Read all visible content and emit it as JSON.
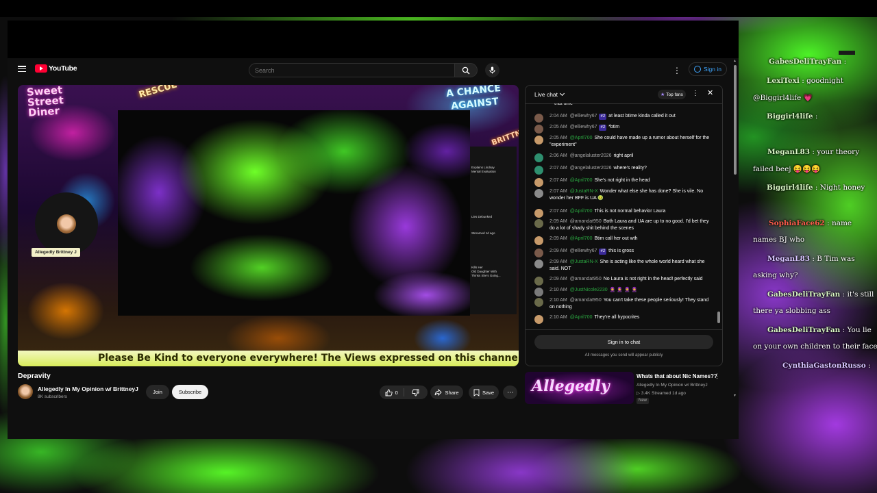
{
  "header": {
    "logo_text": "YouTube",
    "search_placeholder": "Search",
    "more_icon": "⋮",
    "sign_in_label": "Sign in"
  },
  "video": {
    "title": "Depravity",
    "overlay": {
      "sign_diner": "Sweet\nStreet\nDiner",
      "sign_rescue": "RESCUE",
      "sign_chance": "A CHANCE\nAGAINST",
      "sign_brittney": "BRITTNEY",
      "name_tag": "Allegedly Brittney J",
      "side_panel": [
        "Explains Lindsay",
        "Mental Evaluation",
        "Lies Debunked",
        "Streamed 1d ago",
        "Kills Her",
        "Old Daughter With",
        "Thinks She's Going..."
      ],
      "ticker": "Please Be Kind to everyone everywhere! The Views expressed on this channel by Gu"
    },
    "channel": {
      "name": "Allegedly In My Opinion w/ BrittneyJ",
      "subscribers": "8K subscribers"
    },
    "buttons": {
      "join": "Join",
      "subscribe": "Subscribe",
      "like_count": "0",
      "share": "Share",
      "save": "Save",
      "more": "⋯"
    }
  },
  "live_chat": {
    "title": "Live chat",
    "top_fans": "Top fans",
    "messages": [
      {
        "time": "",
        "author": "",
        "text": "that time",
        "author_color": "gray",
        "badge": ""
      },
      {
        "time": "2:04 AM",
        "author": "@elliewhy67",
        "text": "at least btime kinda called it out",
        "author_color": "gray",
        "badge": "#2"
      },
      {
        "time": "2:05 AM",
        "author": "@elliewhy67",
        "text": "*btim",
        "author_color": "gray",
        "badge": "#2"
      },
      {
        "time": "2:05 AM",
        "author": "@April700",
        "text": "She could have made up a rumor about herself for the \"experiment\"",
        "author_color": "green",
        "badge": ""
      },
      {
        "time": "2:06 AM",
        "author": "@angelaluster2026",
        "text": "right april",
        "author_color": "gray",
        "badge": ""
      },
      {
        "time": "2:07 AM",
        "author": "@angelaluster2026",
        "text": "where's reality?",
        "author_color": "gray",
        "badge": ""
      },
      {
        "time": "2:07 AM",
        "author": "@April700",
        "text": "She's not right in the head",
        "author_color": "green",
        "badge": ""
      },
      {
        "time": "2:07 AM",
        "author": "@JustaRN-X",
        "text": "Wonder what else she has done? She is vile. No wonder her BFF is UA 🤢",
        "author_color": "green",
        "badge": ""
      },
      {
        "time": "2:07 AM",
        "author": "@April700",
        "text": "This is not normal behavior Laura",
        "author_color": "green",
        "badge": ""
      },
      {
        "time": "2:09 AM",
        "author": "@amandat950",
        "text": "Both Laura and UA are up to no good. I'd bet they do a lot of shady shit behind the scenes",
        "author_color": "gray",
        "badge": ""
      },
      {
        "time": "2:09 AM",
        "author": "@April700",
        "text": "Btim call her out wth",
        "author_color": "green",
        "badge": ""
      },
      {
        "time": "2:09 AM",
        "author": "@elliewhy67",
        "text": "this is gross",
        "author_color": "gray",
        "badge": "#2"
      },
      {
        "time": "2:09 AM",
        "author": "@JustaRN-X",
        "text": "She is acting like the whole world heard what she said. NOT",
        "author_color": "green",
        "badge": ""
      },
      {
        "time": "2:09 AM",
        "author": "@amandat950",
        "text": "No Laura is not right in the head! perfectly said",
        "author_color": "gray",
        "badge": ""
      },
      {
        "time": "2:10 AM",
        "author": "@JustNicole2230",
        "text": "🧕 🧕 🧕 🧕",
        "author_color": "green",
        "badge": ""
      },
      {
        "time": "2:10 AM",
        "author": "@amandat950",
        "text": "You can't take these people seriously! They stand on nothing",
        "author_color": "gray",
        "badge": ""
      },
      {
        "time": "2:10 AM",
        "author": "@April700",
        "text": "They're all hypocrites",
        "author_color": "green",
        "badge": ""
      }
    ],
    "sign_in_chat": "Sign in to chat",
    "note": "All messages you send will appear publicly"
  },
  "recommendation": {
    "thumb_text": "Allegedly",
    "title": "Whats that about Nic Names??",
    "channel": "Allegedly In My Opinion w/ BrittneyJ",
    "stats": "▷ 3.4K  Streamed 1d ago",
    "badge": "New"
  },
  "overlay_chat": [
    {
      "name": "GabesDeliTrayFan",
      "text": ":",
      "color": "lg"
    },
    {
      "name": "LexiTexi",
      "text": ": goodnight",
      "color": "lg"
    },
    {
      "name": "",
      "text": "@Biggirl4life 💗",
      "color": ""
    },
    {
      "name": "Biggirl4life",
      "text": ":",
      "color": "lg"
    },
    {
      "name": "MeganL83",
      "text": ": your theory",
      "color": "lg"
    },
    {
      "name": "",
      "text": "failed beej 😝😝😝",
      "color": ""
    },
    {
      "name": "Biggirl4life",
      "text": ": Night honey",
      "color": "lg"
    },
    {
      "name": "SophiaFace62",
      "text": ": name",
      "color": "red"
    },
    {
      "name": "",
      "text": "names BJ who",
      "color": ""
    },
    {
      "name": "MeganL83",
      "text": ": B Tim was",
      "color": "pu"
    },
    {
      "name": "",
      "text": "asking why?",
      "color": ""
    },
    {
      "name": "GabesDeliTrayFan",
      "text": ": it's still",
      "color": "lg"
    },
    {
      "name": "",
      "text": "there ya slobbing ass",
      "color": ""
    },
    {
      "name": "GabesDeliTrayFan",
      "text": ": You lie",
      "color": "lg"
    },
    {
      "name": "",
      "text": "on your own children to their face",
      "color": ""
    },
    {
      "name": "CynthiaGastonRusso",
      "text": ":",
      "color": "pu"
    }
  ]
}
